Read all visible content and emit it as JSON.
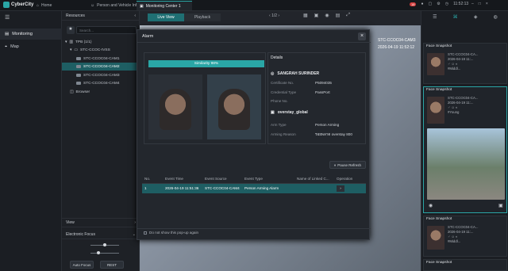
{
  "app": {
    "brand": "CyberCity"
  },
  "topbar": {
    "tabs": [
      {
        "label": "Home"
      },
      {
        "label": "Person and Vehicle Info"
      },
      {
        "label": "Monitoring Center 1"
      }
    ],
    "alarm_count": "18",
    "clock": "11:52:13"
  },
  "leftnav": {
    "items": [
      {
        "label": "Monitoring"
      },
      {
        "label": "Map"
      }
    ]
  },
  "resources": {
    "title": "Resources",
    "search_placeholder": "Search...",
    "tree": [
      {
        "label": "TPB (1/1)"
      },
      {
        "label": "STC-CCOC-IVSS"
      },
      {
        "label": "STC-CCOC04-CAM1"
      },
      {
        "label": "STC-CCOC04-CAM2"
      },
      {
        "label": "STC-CCOC04-CAM3"
      },
      {
        "label": "STC-CCOC04-CAM4"
      },
      {
        "label": "Browser"
      }
    ],
    "view_label": "View",
    "focus_label": "Electronic Focus",
    "auto_focus": "Auto Focus",
    "reset": "REST"
  },
  "center": {
    "live_view": "Live View",
    "playback": "Playback",
    "page": "1/2",
    "overlay_cam": "STC-CCOC04-CAM3",
    "overlay_time": "2026-04-19 11:52:12"
  },
  "alarm_dialog": {
    "title": "Alarm",
    "similarity": "Similarity  98%",
    "details_title": "Details",
    "person_name": "SANGRAH SURINDER",
    "details": [
      {
        "key": "Certificate No.",
        "value": "P5094035"
      },
      {
        "key": "Credential Type",
        "value": "PassPort"
      },
      {
        "key": "Phone No.",
        "value": ""
      }
    ],
    "list_name": "overstay_global",
    "arm_details": [
      {
        "key": "Arm Type",
        "value": "Person Arming"
      },
      {
        "key": "Arming Reason",
        "value": "รอยพลาด overstay 800"
      }
    ],
    "pause_refresh": "Pause Refresh",
    "table_headers": [
      "No.",
      "Event Time",
      "Event Source",
      "Event Type",
      "Name of Linked C...",
      "Operation"
    ],
    "rows": [
      {
        "no": "1",
        "time": "2026-04-19 11:51:36",
        "source": "STC-CCOC04-CAM4",
        "type": "Person Arming Alarm",
        "linked": ""
      }
    ],
    "dont_show": "Do not show this pop-up again"
  },
  "snapshots": [
    {
      "title": "Face Snapshot",
      "cam": "STC-CCOC04-CA...",
      "time": "2026-04-19 11:...",
      "tag": "#Middl..."
    },
    {
      "title": "Face Snapshot",
      "cam": "STC-CCOC04-CA...",
      "time": "2026-04-19 11:...",
      "tag": "#Young"
    },
    {
      "title": "Face Snapshot",
      "cam": "STC-CCOC04-CA...",
      "time": "2026-04-19 11:...",
      "tag": "#Middl..."
    },
    {
      "title": "Face Snapshot",
      "cam": "STC-CCOC04-CA...",
      "time": "2026-04-19 11:...",
      "tag": ""
    }
  ]
}
